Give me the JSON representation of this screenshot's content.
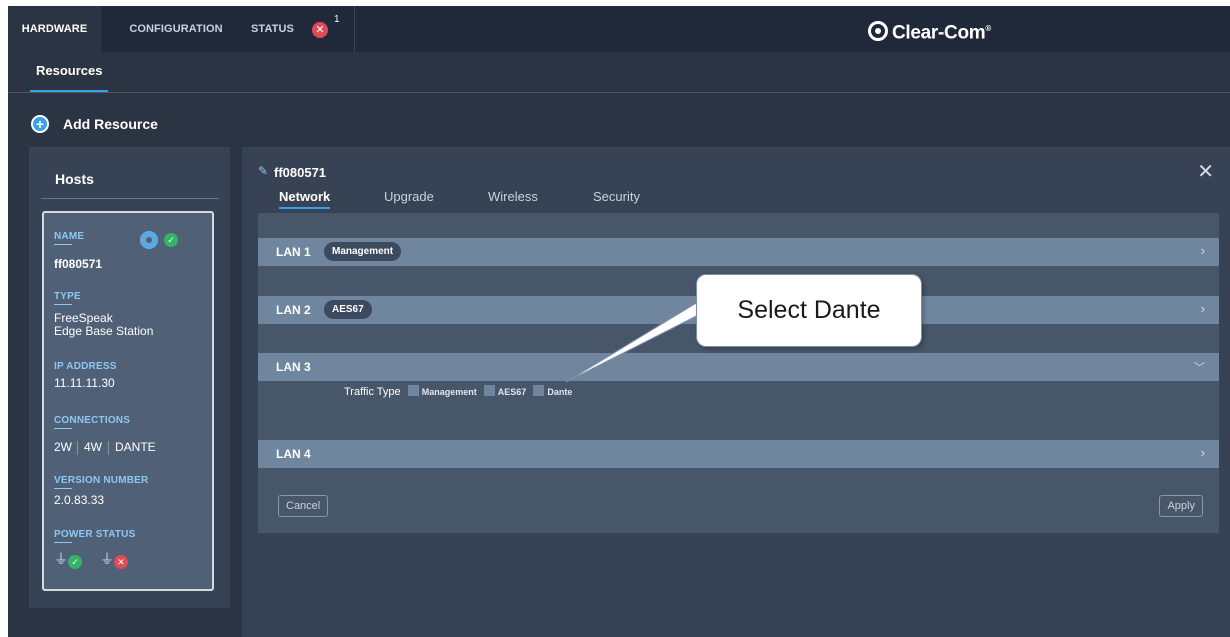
{
  "topnav": {
    "tabs": [
      {
        "label": "HARDWARE",
        "active": true
      },
      {
        "label": "CONFIGURATION",
        "active": false
      },
      {
        "label": "STATUS",
        "active": false
      }
    ],
    "status_badge_count": "1",
    "status_badge_icon": "close-icon",
    "brand": "Clear-Com",
    "brand_mark": "®"
  },
  "subnav": {
    "tab": "Resources"
  },
  "add_resource": {
    "label": "Add Resource",
    "icon": "plus-icon"
  },
  "hosts": {
    "title": "Hosts",
    "card": {
      "name_label": "NAME",
      "name_value": "ff080571",
      "type_label": "TYPE",
      "type_value_line1": "FreeSpeak",
      "type_value_line2": "Edge Base Station",
      "ip_label": "IP ADDRESS",
      "ip_value": "11.11.11.30",
      "connections_label": "CONNECTIONS",
      "connections": [
        "2W",
        "4W",
        "DANTE"
      ],
      "version_label": "VERSION NUMBER",
      "version_value": "2.0.83.33",
      "power_label": "POWER STATUS",
      "power": [
        {
          "status": "ok"
        },
        {
          "status": "error"
        }
      ]
    }
  },
  "detail": {
    "title": "ff080571",
    "tabs": [
      {
        "label": "Network",
        "active": true
      },
      {
        "label": "Upgrade",
        "active": false
      },
      {
        "label": "Wireless",
        "active": false
      },
      {
        "label": "Security",
        "active": false
      }
    ],
    "lans": [
      {
        "label": "LAN 1",
        "pill": "Management",
        "expanded": false
      },
      {
        "label": "LAN 2",
        "pill": "AES67",
        "expanded": false
      },
      {
        "label": "LAN 3",
        "pill": "",
        "expanded": true
      },
      {
        "label": "LAN 4",
        "pill": "",
        "expanded": false
      }
    ],
    "traffic_type_label": "Traffic Type",
    "traffic_options": [
      "Management",
      "AES67",
      "Dante"
    ],
    "cancel_label": "Cancel",
    "apply_label": "Apply"
  },
  "callout": {
    "text": "Select Dante"
  },
  "colors": {
    "accent": "#3aa0e6",
    "background": "#2b3442",
    "panel": "#374355",
    "lan_header": "#6f869e",
    "ok": "#34b36a",
    "error": "#e04b57"
  }
}
